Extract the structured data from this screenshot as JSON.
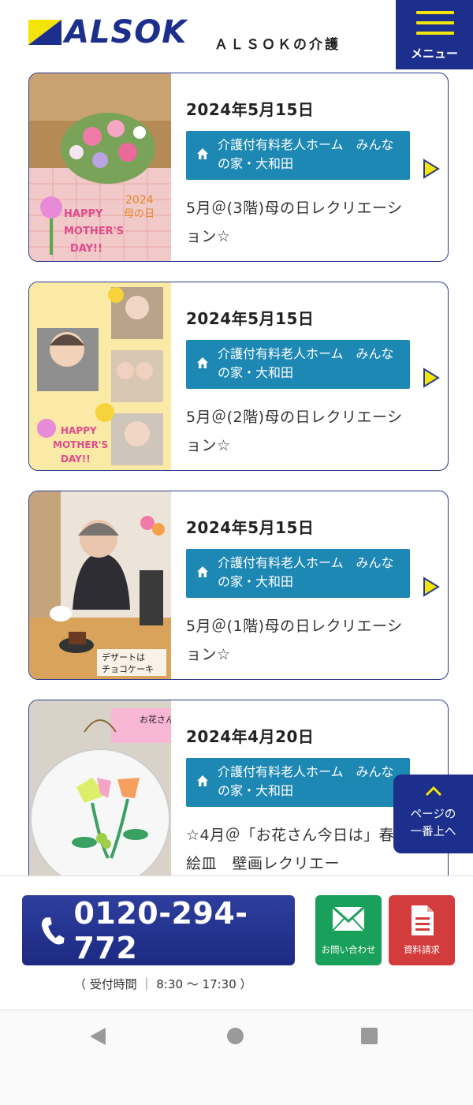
{
  "header": {
    "logo_text": "ALSOK",
    "subtitle": "ＡＬＳＯＫの介護",
    "menu_label": "メニュー"
  },
  "posts": [
    {
      "date": "2024年5月15日",
      "facility": "介護付有料老人ホーム　みんなの家・大和田",
      "title": "5月＠(3階)母の日レクリエーション☆",
      "thumb_caption": "2024 母の日 HAPPY MOTHER'S DAY!!"
    },
    {
      "date": "2024年5月15日",
      "facility": "介護付有料老人ホーム　みんなの家・大和田",
      "title": "5月＠(2階)母の日レクリエーション☆",
      "thumb_caption": "HAPPY MOTHER'S DAY!!"
    },
    {
      "date": "2024年5月15日",
      "facility": "介護付有料老人ホーム　みんなの家・大和田",
      "title": "5月＠(1階)母の日レクリエーション☆",
      "thumb_caption": "デザートは チョコケーキ"
    },
    {
      "date": "2024年4月20日",
      "facility": "介護付有料老人ホーム　みんなの家・大和田",
      "title": "☆4月＠「お花さん今日は」春の絵皿　壁画レクリエー",
      "thumb_caption": "お花さん"
    }
  ],
  "to_top": {
    "line1": "ページの",
    "line2": "一番上へ"
  },
  "contact": {
    "phone": "0120-294-772",
    "hours": "（ 受付時間 ｜ 8:30 〜 17:30 ）",
    "inquiry_label": "お問い合わせ",
    "brochure_label": "資料請求"
  },
  "colors": {
    "brand_navy": "#1d2f8c",
    "brand_yellow": "#f3e40a",
    "facility_blue": "#1e88b4",
    "inquiry_green": "#19a05a",
    "brochure_red": "#d23c3c"
  }
}
